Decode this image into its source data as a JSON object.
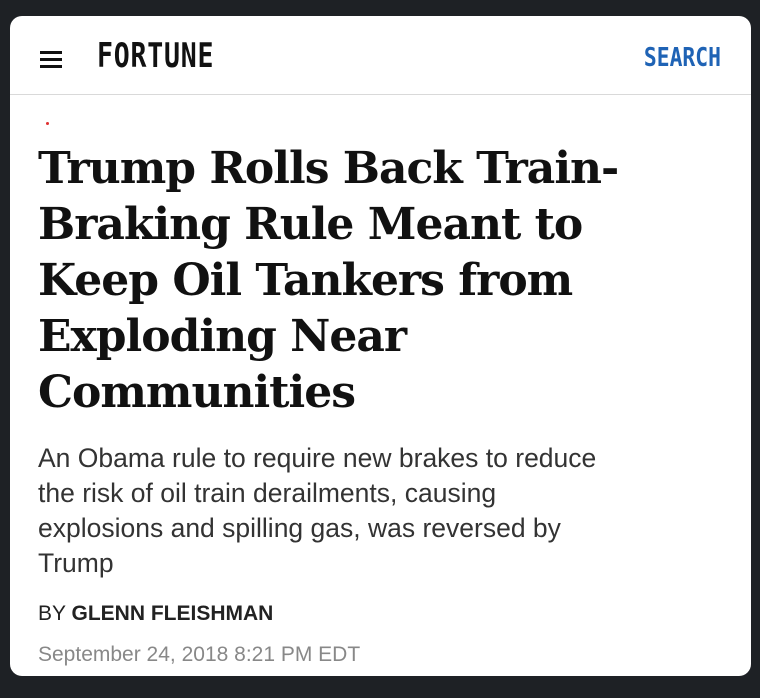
{
  "header": {
    "logo_text": "FORTUNE",
    "search_label": "SEARCH",
    "menu_icon": "hamburger-menu-icon"
  },
  "article": {
    "headline": "Trump Rolls Back Train-Braking Rule Meant to Keep Oil Tankers from Exploding Near Communities",
    "headline_lines": [
      "Trump Rolls Back Train-",
      "Braking Rule Meant to",
      "Keep Oil Tankers from",
      "Exploding Near",
      "Communities"
    ],
    "dek_lines": [
      "An Obama rule to require new brakes to reduce",
      "the risk of oil train derailments, causing",
      "explosions and spilling gas, was reversed by",
      "Trump"
    ],
    "byline_prefix": "BY",
    "author": "GLENN FLEISHMAN",
    "timestamp": "September 24, 2018 8:21 PM EDT"
  },
  "colors": {
    "search_link": "#1f63b5",
    "accent_dot": "#e03030",
    "timestamp": "#888888"
  }
}
